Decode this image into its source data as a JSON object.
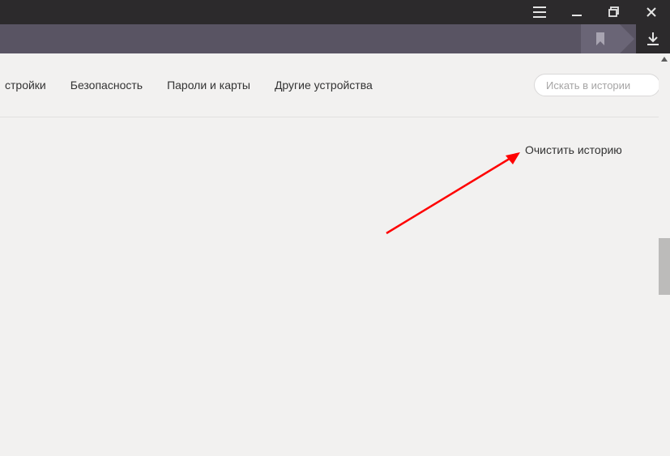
{
  "nav": {
    "tabs": {
      "cut": "стройки",
      "security": "Безопасность",
      "passwords": "Пароли и карты",
      "other_devices": "Другие устройства"
    },
    "search_placeholder": "Искать в истории"
  },
  "content": {
    "clear_history": "Очистить историю"
  }
}
